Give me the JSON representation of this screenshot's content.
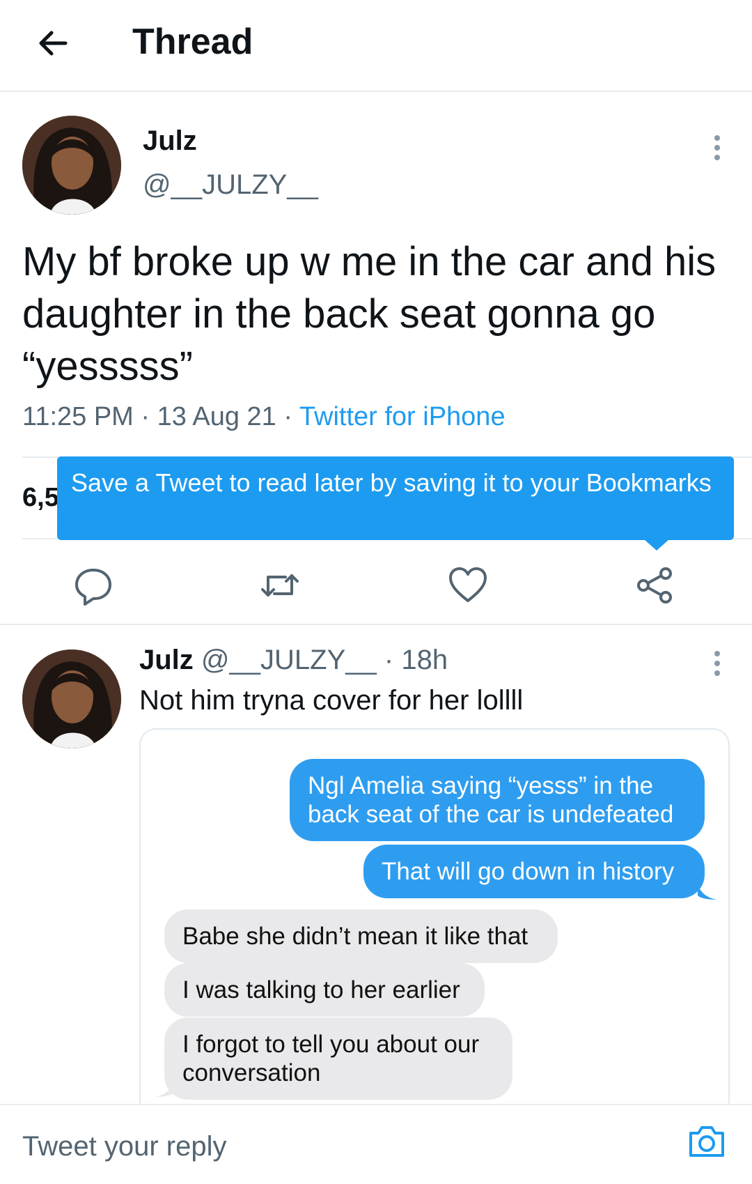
{
  "header": {
    "title": "Thread",
    "back_icon": "arrow-left-icon"
  },
  "main_tweet": {
    "name": "Julz",
    "handle": "@__JULZY__",
    "text": "My bf broke up w me in the car and his daughter in the back seat gonna go “yesssss”",
    "time": "11:25 PM",
    "date": "13 Aug 21",
    "source": "Twitter for iPhone",
    "stats_visible": "6,5",
    "tooltip": "Save a Tweet to read later by saving it to your Bookmarks",
    "actions": [
      "reply-icon",
      "retweet-icon",
      "like-icon",
      "share-icon"
    ]
  },
  "reply_tweet": {
    "name": "Julz",
    "handle": "@__JULZY__",
    "time": "18h",
    "text": "Not him tryna cover for her lollll",
    "messages": [
      {
        "side": "sent",
        "text": "Ngl Amelia saying “yesss” in the back seat of the car is undefeated"
      },
      {
        "side": "sent",
        "text": "That will go down in history"
      },
      {
        "side": "received",
        "text": "Babe she didn’t mean it like that"
      },
      {
        "side": "received",
        "text": "I was talking to her earlier"
      },
      {
        "side": "received",
        "text": "I forgot to tell you about our conversation"
      }
    ]
  },
  "composer": {
    "placeholder": "Tweet your reply",
    "camera_icon": "camera-icon"
  },
  "colors": {
    "accent": "#1d9bf0",
    "imessage_blue": "#2e9df0",
    "imessage_gray": "#e9e9eb"
  }
}
